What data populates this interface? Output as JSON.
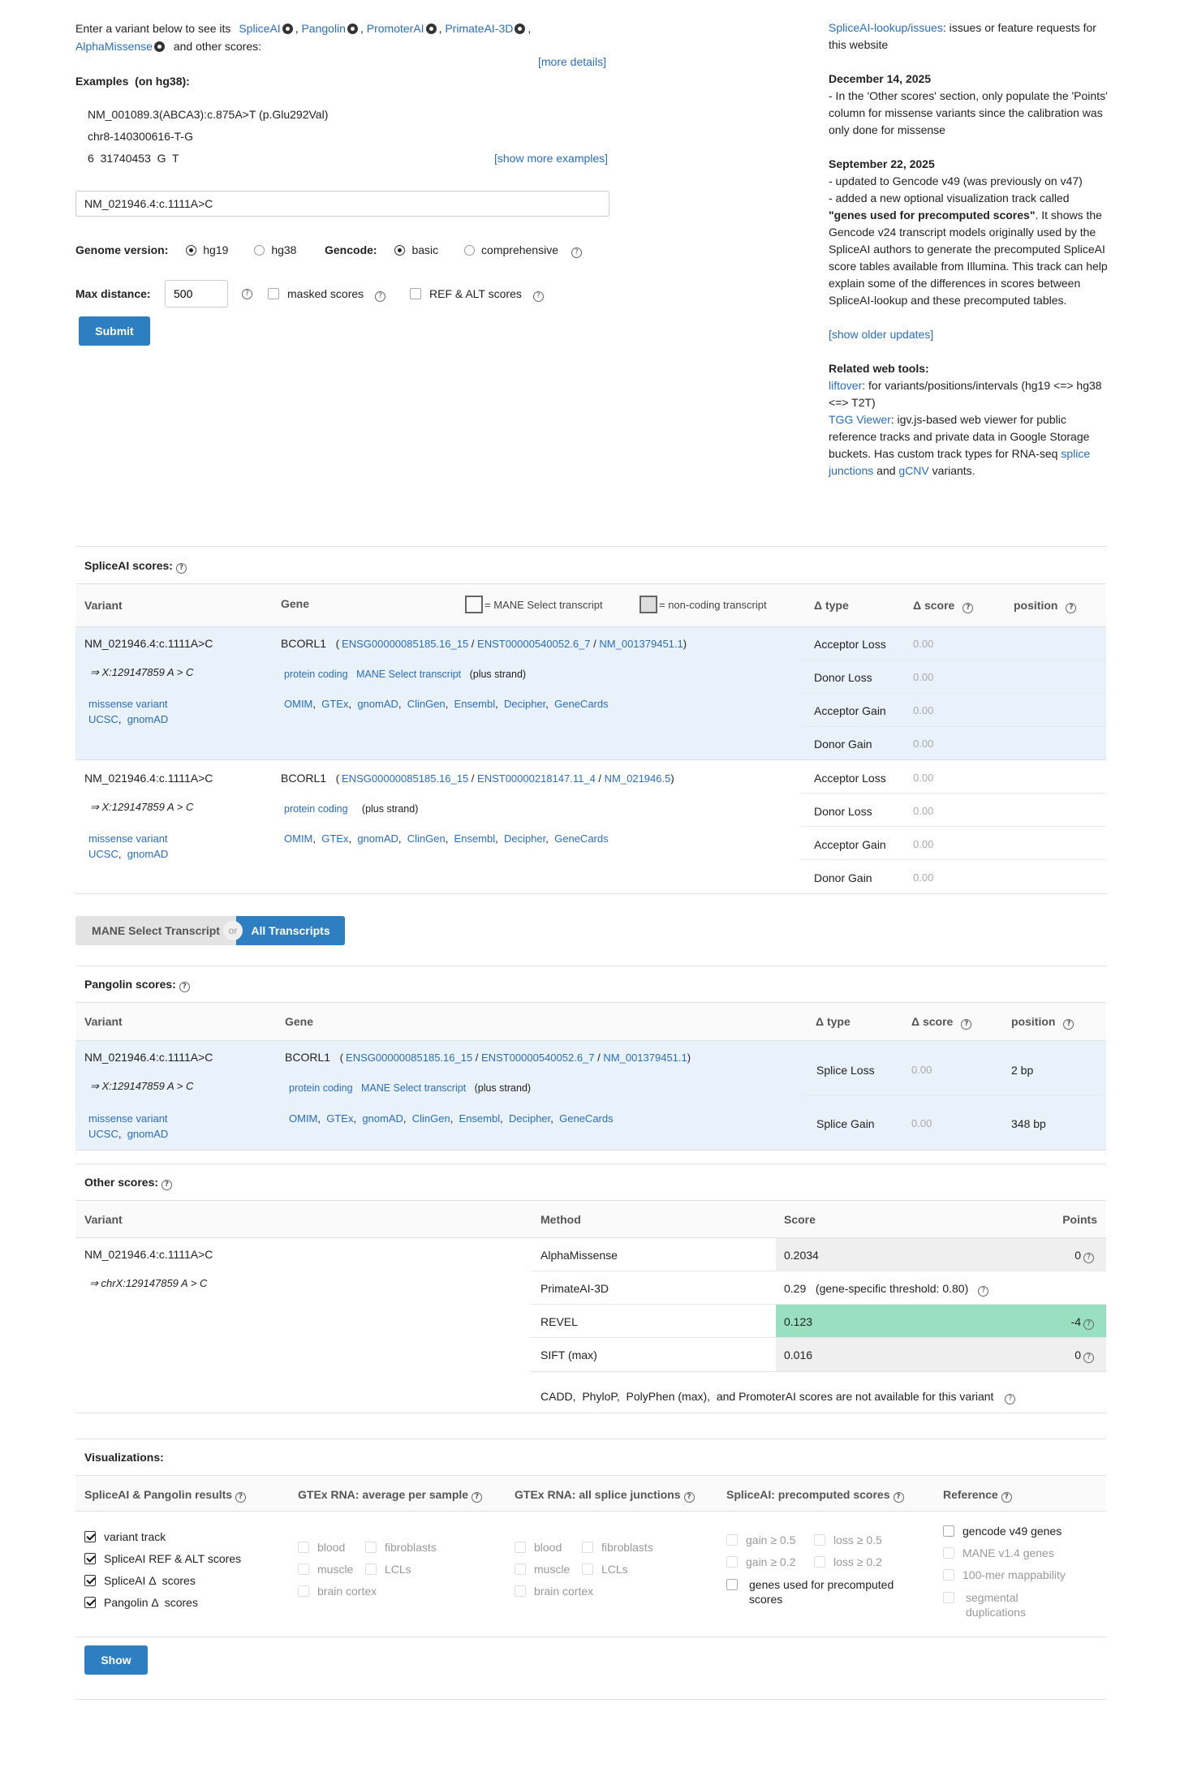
{
  "intro": {
    "prefix": "Enter a variant below to see its",
    "tools": [
      "SpliceAI",
      "Pangolin",
      "PromoterAI",
      "PrimateAI-3D",
      "AlphaMissense"
    ],
    "suffix": "and other scores:",
    "more_details": "[more details]"
  },
  "examples": {
    "label": "Examples",
    "note": "(on hg38):",
    "items": [
      "NM_001089.3(ABCA3):c.875A>T (p.Glu292Val)",
      "chr8-140300616-T-G",
      "6  31740453  G  T"
    ],
    "show_more": "[show more examples]"
  },
  "input_value": "NM_021946.4:c.1111A>C",
  "options": {
    "genome_label": "Genome version:",
    "genome_opts": [
      "hg19",
      "hg38"
    ],
    "gencode_label": "Gencode:",
    "gencode_opts": [
      "basic",
      "comprehensive"
    ],
    "maxdist_label": "Max distance:",
    "maxdist_value": "500",
    "masked": "masked scores",
    "refalt": "REF & ALT scores",
    "submit": "Submit"
  },
  "right": {
    "issues_link": "SpliceAI-lookup/issues",
    "issues_text": ": issues or feature requests for this website",
    "u1_date": "December 14, 2025",
    "u1_text": "- In the 'Other scores' section, only populate the 'Points' column for missense variants since the calibration was only done for missense",
    "u2_date": "September 22, 2025",
    "u2_l1": "- updated to Gencode v49 (was previously on v47)",
    "u2_l2": "- added a new optional visualization track called",
    "u2_bold": "\"genes used for precomputed scores\"",
    "u2_rest": ". It shows the Gencode v24 transcript models originally used by the SpliceAI authors to generate the precomputed SpliceAI score tables available from Illumina. This track can help explain some of the differences in scores between SpliceAI-lookup and these precomputed tables.",
    "older": "[show older updates]",
    "related_title": "Related web tools:",
    "liftover": "liftover",
    "liftover_text": ": for variants/positions/intervals (hg19 <=> hg38 <=> T2T)",
    "tgg": "TGG Viewer",
    "tgg_text": ": igv.js-based web viewer for public reference tracks and private data in Google Storage buckets. Has custom track types for RNA-seq",
    "splice_junctions": "splice junctions",
    "and": "and",
    "gcnv": "gCNV",
    "variants": "variants."
  },
  "spliceai": {
    "title": "SpliceAI scores:",
    "h_variant": "Variant",
    "h_gene": "Gene",
    "legend_mane": "= MANE Select transcript",
    "legend_noncoding": "= non-coding transcript",
    "h_type": "Δ type",
    "h_score": "Δ score",
    "h_pos": "position",
    "rows": [
      {
        "variant": "NM_021946.4:c.1111A>C",
        "coord": "⇒ X:129147859 A > C",
        "conseq": "missense variant",
        "ucsc": "UCSC",
        "gnomad": "gnomAD",
        "gene": "BCORL1",
        "ensg": "ENSG00000085185.16_15",
        "enst": "ENST00000540052.6_7",
        "nm": "NM_001379451.1",
        "biotype": "protein coding",
        "mane": "MANE Select transcript",
        "strand": "(plus strand)",
        "links": [
          "OMIM",
          "GTEx",
          "gnomAD",
          "ClinGen",
          "Ensembl",
          "Decipher",
          "GeneCards"
        ],
        "types": [
          "Acceptor Loss",
          "Donor Loss",
          "Acceptor Gain",
          "Donor Gain"
        ],
        "scores": [
          "0.00",
          "0.00",
          "0.00",
          "0.00"
        ]
      },
      {
        "variant": "NM_021946.4:c.1111A>C",
        "coord": "⇒ X:129147859 A > C",
        "conseq": "missense variant",
        "ucsc": "UCSC",
        "gnomad": "gnomAD",
        "gene": "BCORL1",
        "ensg": "ENSG00000085185.16_15",
        "enst": "ENST00000218147.11_4",
        "nm": "NM_021946.5",
        "biotype": "protein coding",
        "strand": "(plus strand)",
        "links": [
          "OMIM",
          "GTEx",
          "gnomAD",
          "ClinGen",
          "Ensembl",
          "Decipher",
          "GeneCards"
        ],
        "types": [
          "Acceptor Loss",
          "Donor Loss",
          "Acceptor Gain",
          "Donor Gain"
        ],
        "scores": [
          "0.00",
          "0.00",
          "0.00",
          "0.00"
        ]
      }
    ]
  },
  "toggle": {
    "mane": "MANE Select Transcript",
    "or": "or",
    "all": "All Transcripts"
  },
  "pangolin": {
    "title": "Pangolin scores:",
    "h_variant": "Variant",
    "h_gene": "Gene",
    "h_type": "Δ type",
    "h_score": "Δ score",
    "h_pos": "position",
    "row": {
      "variant": "NM_021946.4:c.1111A>C",
      "coord": "⇒ X:129147859 A > C",
      "conseq": "missense variant",
      "ucsc": "UCSC",
      "gnomad": "gnomAD",
      "gene": "BCORL1",
      "ensg": "ENSG00000085185.16_15",
      "enst": "ENST00000540052.6_7",
      "nm": "NM_001379451.1",
      "biotype": "protein coding",
      "mane": "MANE Select transcript",
      "strand": "(plus strand)",
      "links": [
        "OMIM",
        "GTEx",
        "gnomAD",
        "ClinGen",
        "Ensembl",
        "Decipher",
        "GeneCards"
      ],
      "types": [
        "Splice Loss",
        "Splice Gain"
      ],
      "scores": [
        "0.00",
        "0.00"
      ],
      "positions": [
        "2 bp",
        "348 bp"
      ]
    }
  },
  "other": {
    "title": "Other scores:",
    "h_variant": "Variant",
    "h_method": "Method",
    "h_score": "Score",
    "h_points": "Points",
    "variant": "NM_021946.4:c.1111A>C",
    "coord": "⇒ chrX:129147859 A > C",
    "rows": [
      {
        "method": "AlphaMissense",
        "score": "0.2034",
        "points": "0"
      },
      {
        "method": "PrimateAI-3D",
        "score": "0.29",
        "note": "(gene-specific threshold: 0.80)"
      },
      {
        "method": "REVEL",
        "score": "0.123",
        "points": "-4"
      },
      {
        "method": "SIFT (max)",
        "score": "0.016",
        "points": "0"
      }
    ],
    "na_note": "CADD,  PhyloP,  PolyPhen (max),  and PromoterAI scores are not available for this variant",
    "revel_color": "#98e0c0"
  },
  "vis": {
    "title": "Visualizations:",
    "c1_title": "SpliceAI & Pangolin results",
    "c1_items": [
      "variant track",
      "SpliceAI REF & ALT scores",
      "SpliceAI Δ  scores",
      "Pangolin Δ  scores"
    ],
    "c2_title": "GTEx RNA: average per sample",
    "c3_title": "GTEx RNA: all splice junctions",
    "gtex_items": [
      "blood",
      "fibroblasts",
      "muscle",
      "LCLs",
      "brain cortex"
    ],
    "c4_title": "SpliceAI: precomputed scores",
    "c4_items": [
      "gain ≥ 0.5",
      "loss ≥ 0.5",
      "gain ≥ 0.2",
      "loss ≥ 0.2"
    ],
    "c4_last": "genes used for precomputed scores",
    "c5_title": "Reference",
    "c5_items": [
      "gencode v49 genes",
      "MANE v1.4 genes",
      "100-mer mappability",
      "segmental duplications"
    ],
    "show": "Show"
  },
  "colors": {
    "link": "#2a6ebb",
    "button": "#2d7fc1",
    "highlight_row": "#e9f1fb"
  }
}
